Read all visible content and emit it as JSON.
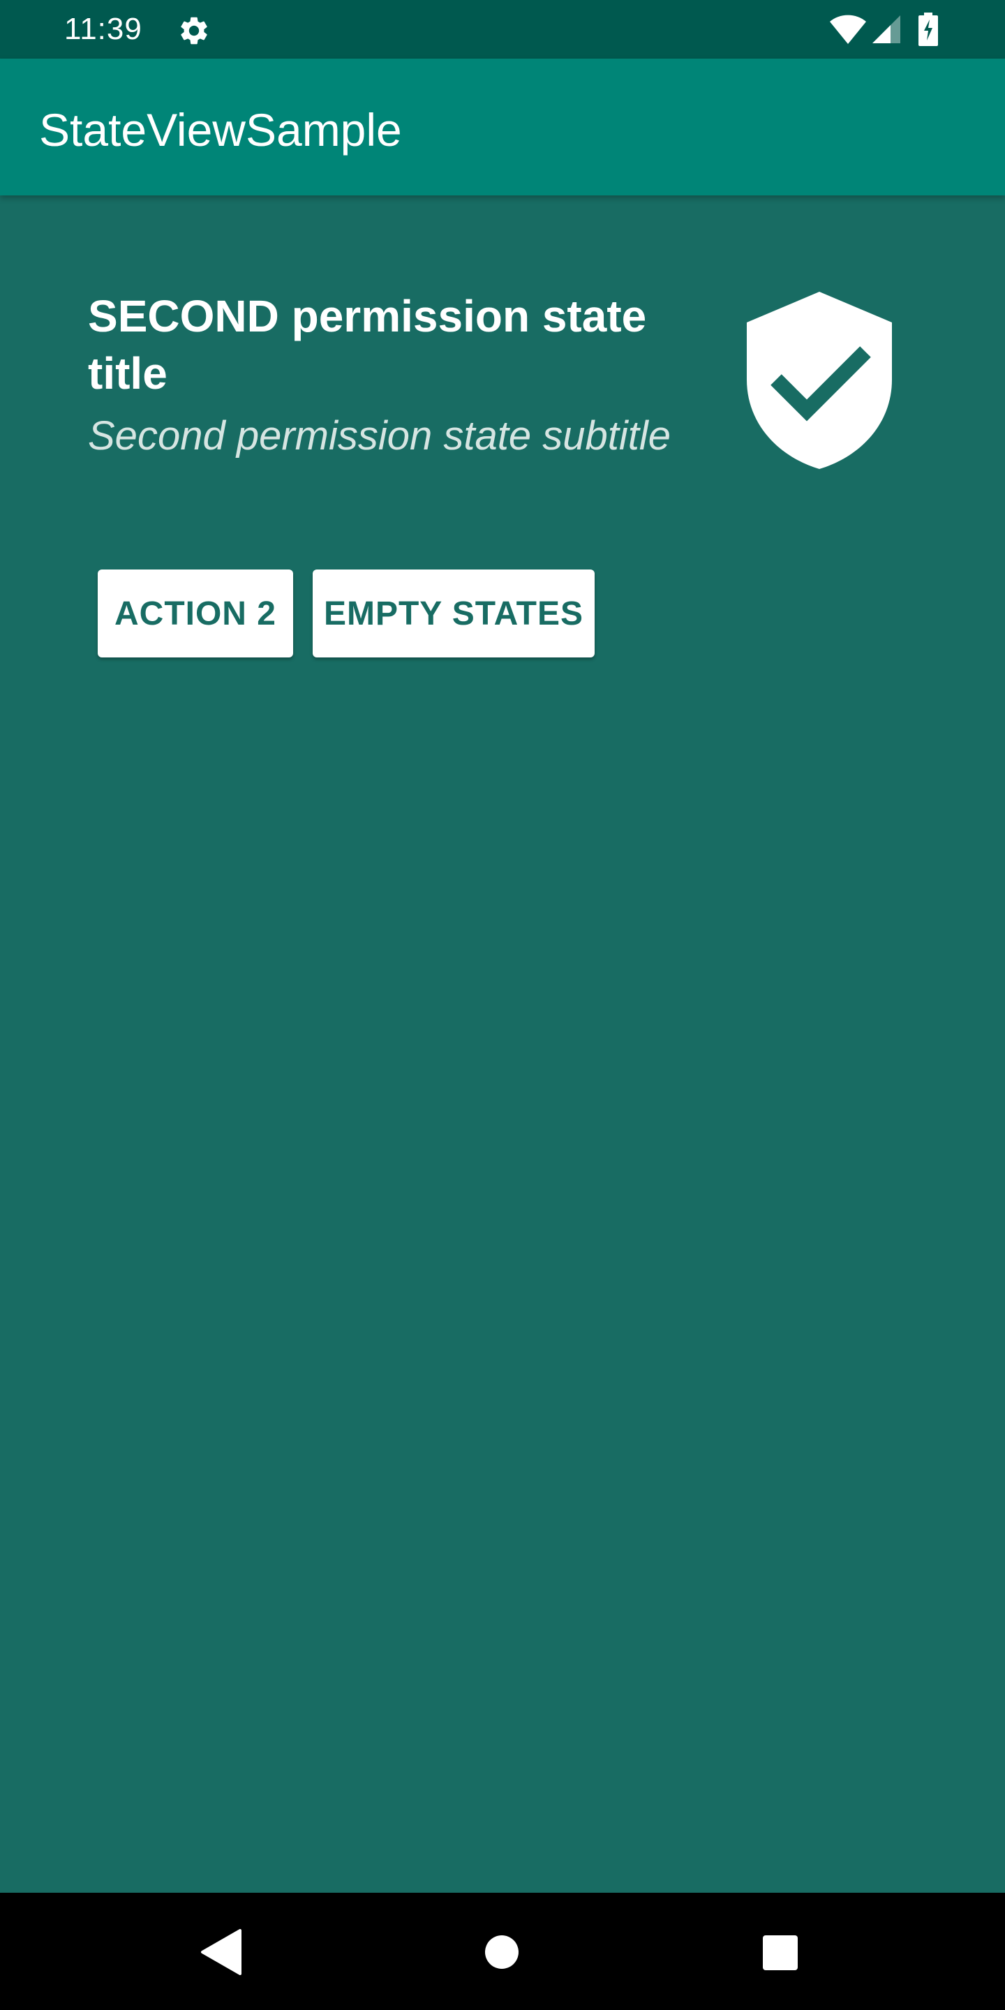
{
  "status_bar": {
    "time": "11:39",
    "icons": [
      "gear-icon",
      "wifi-icon",
      "signal-icon",
      "battery-charging-icon"
    ]
  },
  "app_bar": {
    "title": "StateViewSample"
  },
  "state": {
    "title": "SECOND permission state title",
    "subtitle": "Second permission state subtitle",
    "icon": "shield-check-icon",
    "actions": [
      {
        "label": "ACTION 2"
      },
      {
        "label": "EMPTY STATES"
      }
    ]
  },
  "nav_bar": {
    "icons": [
      "back-icon",
      "home-icon",
      "recents-icon"
    ]
  },
  "colors": {
    "background": "#186c63",
    "app_bar": "#008577",
    "status_bar": "#00594f",
    "accent_text": "#186c63"
  }
}
